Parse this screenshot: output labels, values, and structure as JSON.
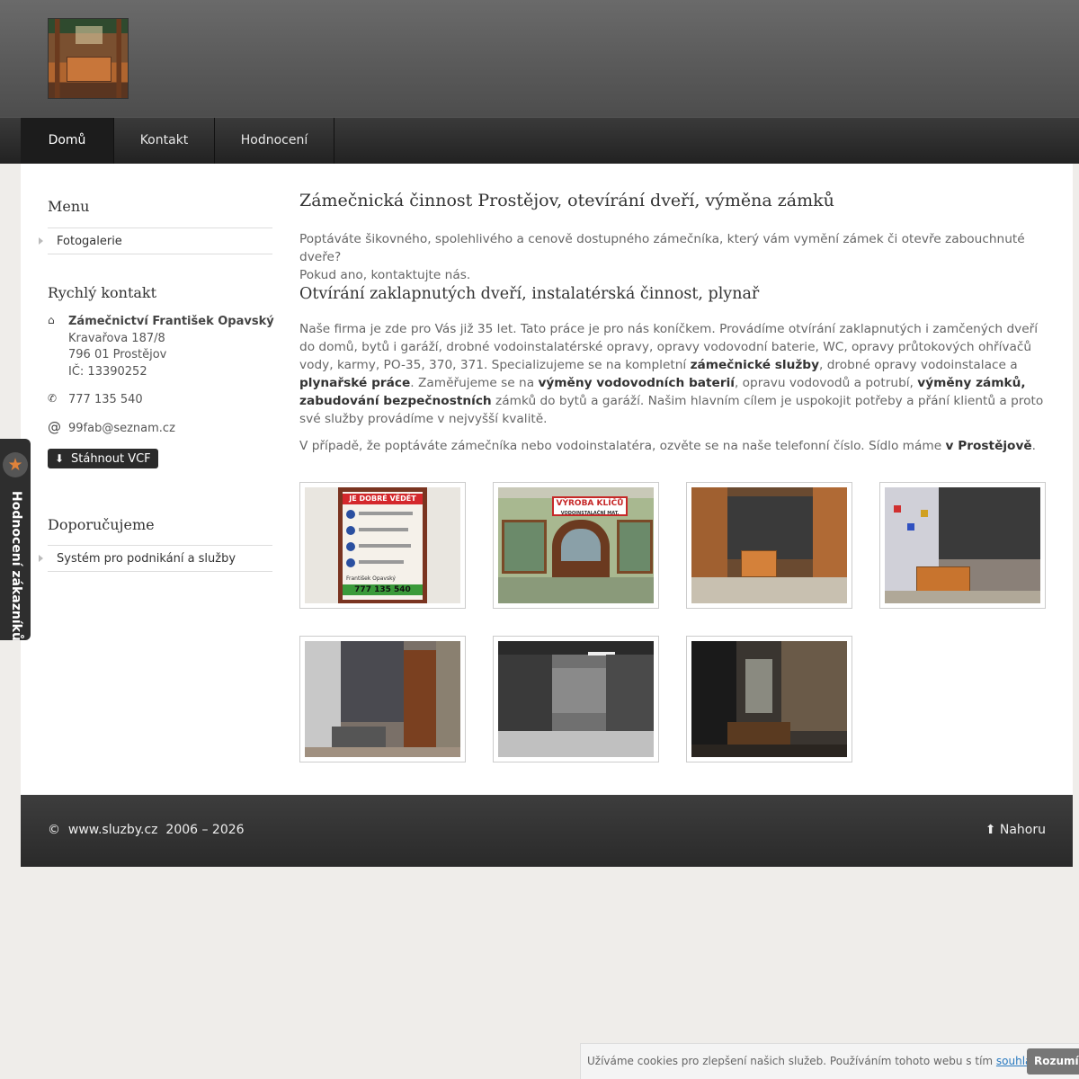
{
  "nav": {
    "items": [
      {
        "label": "Domů",
        "active": true
      },
      {
        "label": "Kontakt",
        "active": false
      },
      {
        "label": "Hodnocení",
        "active": false
      }
    ]
  },
  "sidebar": {
    "menu_title": "Menu",
    "menu_items": [
      "Fotogalerie"
    ],
    "contact_title": "Rychlý kontakt",
    "company": "Zámečnictví František Opavský",
    "street": "Kravařova 187/8",
    "city": "796 01 Prostějov",
    "ic": "IČ: 13390252",
    "phone": "777 135 540",
    "email": "99fab@seznam.cz",
    "vcf_label": "Stáhnout VCF",
    "recommend_title": "Doporučujeme",
    "recommend_items": [
      "Systém pro podnikání a služby"
    ]
  },
  "main": {
    "title": "Zámečnická činnost Prostějov, otevírání dveří, výměna zámků",
    "intro_line1": "Poptáváte šikovného, spolehlivého a cenově dostupného zámečníka, který vám vymění zámek či otevře zabouchnuté dveře?",
    "intro_line2": "Pokud ano, kontaktujte nás.",
    "subtitle": "Otvírání zaklapnutých dveří, instalatérská činnost, plynař",
    "body_1": "Naše firma je zde pro Vás již 35 let. Tato práce je pro nás koníčkem. Provádíme otvírání zaklapnutých i zamčených dveří do domů, bytů i garáží, drobné vodoinstalatérské opravy, opravy vodovodní baterie, WC, opravy průtokových ohřívačů vody, karmy, PO-35, 370, 371. Specializujeme se na kompletní ",
    "bold_1": "zámečnické služby",
    "body_2": ", drobné opravy vodoinstalace a ",
    "bold_2": "plynařské práce",
    "body_3": ". Zaměřujeme se na ",
    "bold_3": "výměny vodovodních baterií",
    "body_4": ", opravu vodovodů a potrubí, ",
    "bold_4": "výměny zámků, zabudování bezpečnostních",
    "body_5": " zámků do bytů a garáží. Našim hlavním cílem je uspokojit potřeby a přání klientů a proto své služby provádíme v nejvyšší kvalitě.",
    "closing": "V případě, že poptáváte zámečníka nebo vodoinstalatéra, ozvěte se na naše telefonní číslo. Sídlo máme ",
    "closing_bold": "v Prostějově",
    "closing_end": ".",
    "gallery": {
      "poster_heading": "JE DOBRÉ VĚDĚT",
      "poster_name": "František Opavský",
      "poster_phone": "777 135 540",
      "shop_sign": "VÝROBA KLÍČŮ",
      "shop_sign_sub": "VODOINSTALAČNÍ MAT."
    }
  },
  "footer": {
    "copyright_symbol": "©",
    "site": "www.sluzby.cz",
    "years": "2006 – 2026",
    "top_label": "Nahoru"
  },
  "rating_tab": {
    "label": "Hodnocení zákazníků"
  },
  "cookie": {
    "text": "Užíváme cookies pro zlepšení našich služeb. Používáním tohoto webu s tím ",
    "link": "souhlasíte",
    "text_end": "..",
    "button": "Rozumím"
  },
  "colors": {
    "accent_star": "#e0823a",
    "link": "#2a7ac0"
  }
}
